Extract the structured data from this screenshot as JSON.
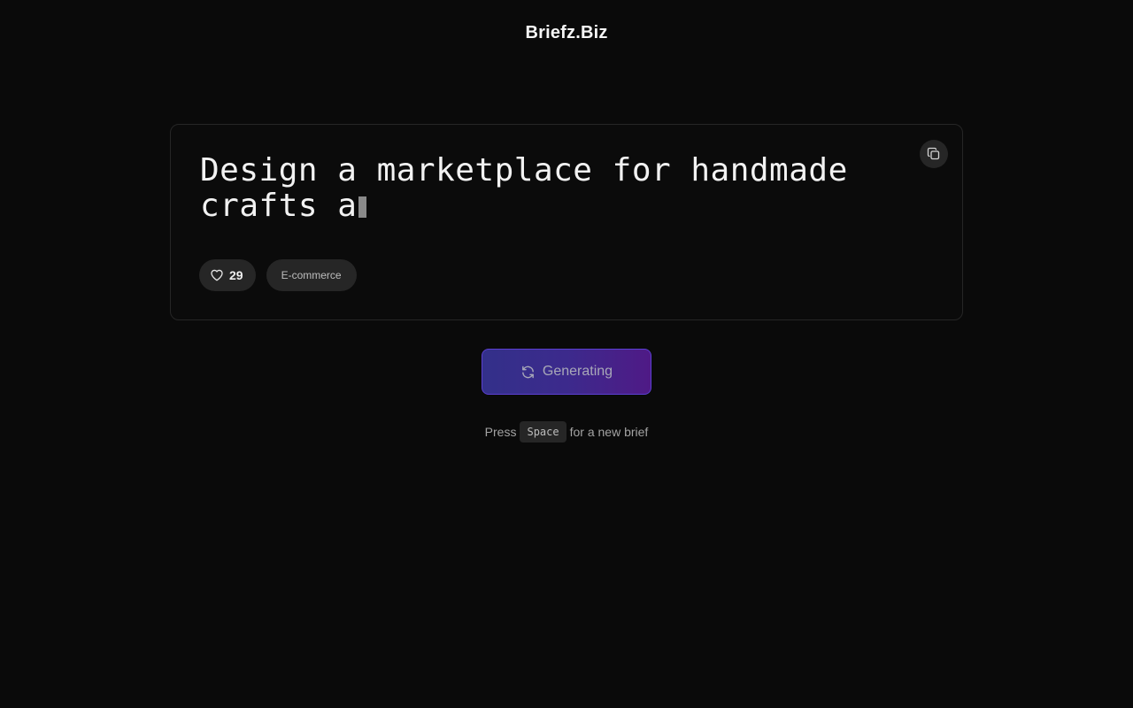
{
  "header": {
    "brand": "Briefz.Biz"
  },
  "card": {
    "brief_text": "Design a marketplace for handmade crafts a",
    "likes": "29",
    "tag": "E-commerce",
    "copy_icon": "copy-icon",
    "like_icon": "heart-icon"
  },
  "generate": {
    "label": "Generating",
    "icon": "refresh-icon"
  },
  "hint": {
    "prefix": "Press",
    "key": "Space",
    "suffix": "for a new brief"
  },
  "colors": {
    "background": "#0a0a0a",
    "card_border": "#262626",
    "chip_bg": "#262626",
    "button_gradient_start": "#33308a",
    "button_gradient_end": "#4f1a86",
    "button_border": "#5b3fd1"
  }
}
